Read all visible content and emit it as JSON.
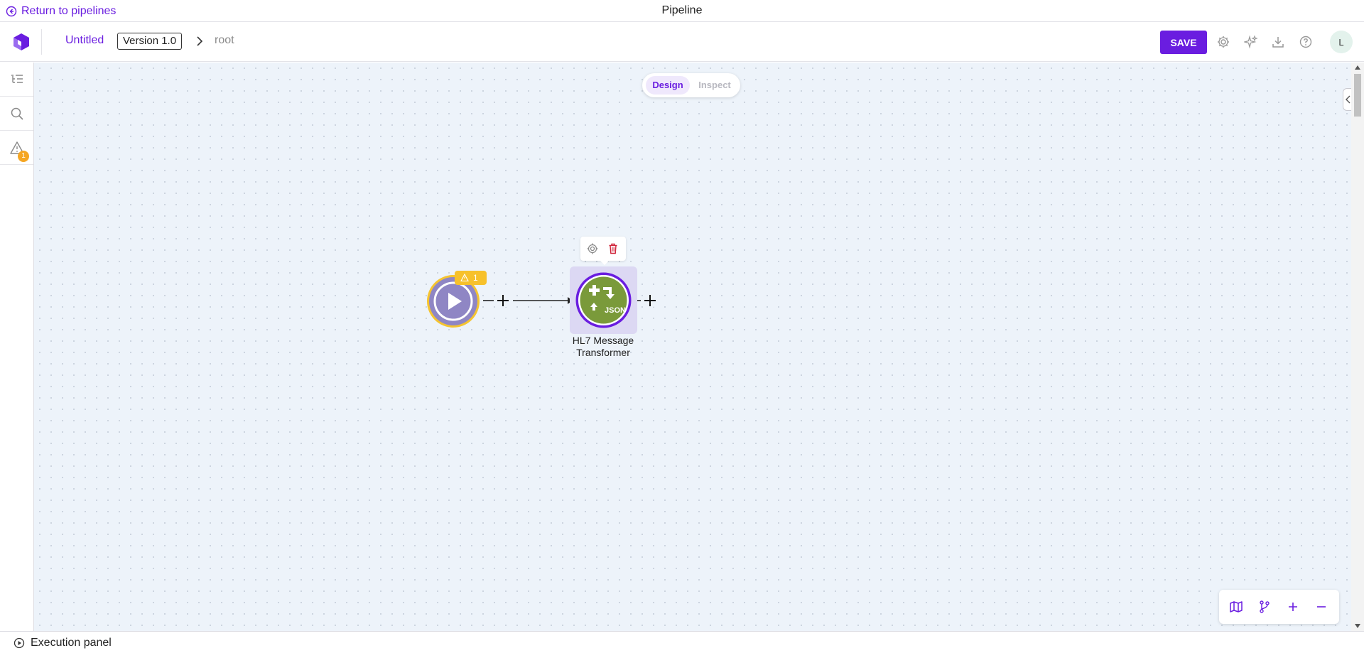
{
  "topbar": {
    "return_label": "Return to pipelines",
    "page_title": "Pipeline"
  },
  "toolbar": {
    "pipeline_name": "Untitled",
    "version": "Version 1.0",
    "breadcrumb_root": "root",
    "save_label": "SAVE",
    "icons": [
      "gear-icon",
      "sparkle-icon",
      "download-icon",
      "help-icon"
    ],
    "avatar_initial": "L"
  },
  "sidebar": {
    "items": [
      {
        "icon": "list-tree-icon"
      },
      {
        "icon": "search-icon"
      },
      {
        "icon": "warning-icon",
        "badge": "1"
      }
    ]
  },
  "canvas": {
    "mode_toggle": {
      "design": "Design",
      "inspect": "Inspect",
      "selected": "Design"
    },
    "start_node": {
      "icon": "play-icon",
      "warning_count": "1"
    },
    "transformer_node": {
      "label_line1": "HL7 Message",
      "label_line2": "Transformer",
      "icon_text": "JSON"
    },
    "node_actions": [
      "gear-icon",
      "trash-icon"
    ]
  },
  "zoom_controls": [
    "map-icon",
    "branch-icon",
    "zoom-in-icon",
    "zoom-out-icon"
  ],
  "execution_panel": {
    "label": "Execution panel"
  },
  "colors": {
    "accent": "#6a1de0",
    "canvas_bg": "#edf3fa",
    "warning": "#f7c12b",
    "node_green": "#7a9a3a",
    "start_node_fill": "#8f86c4"
  }
}
